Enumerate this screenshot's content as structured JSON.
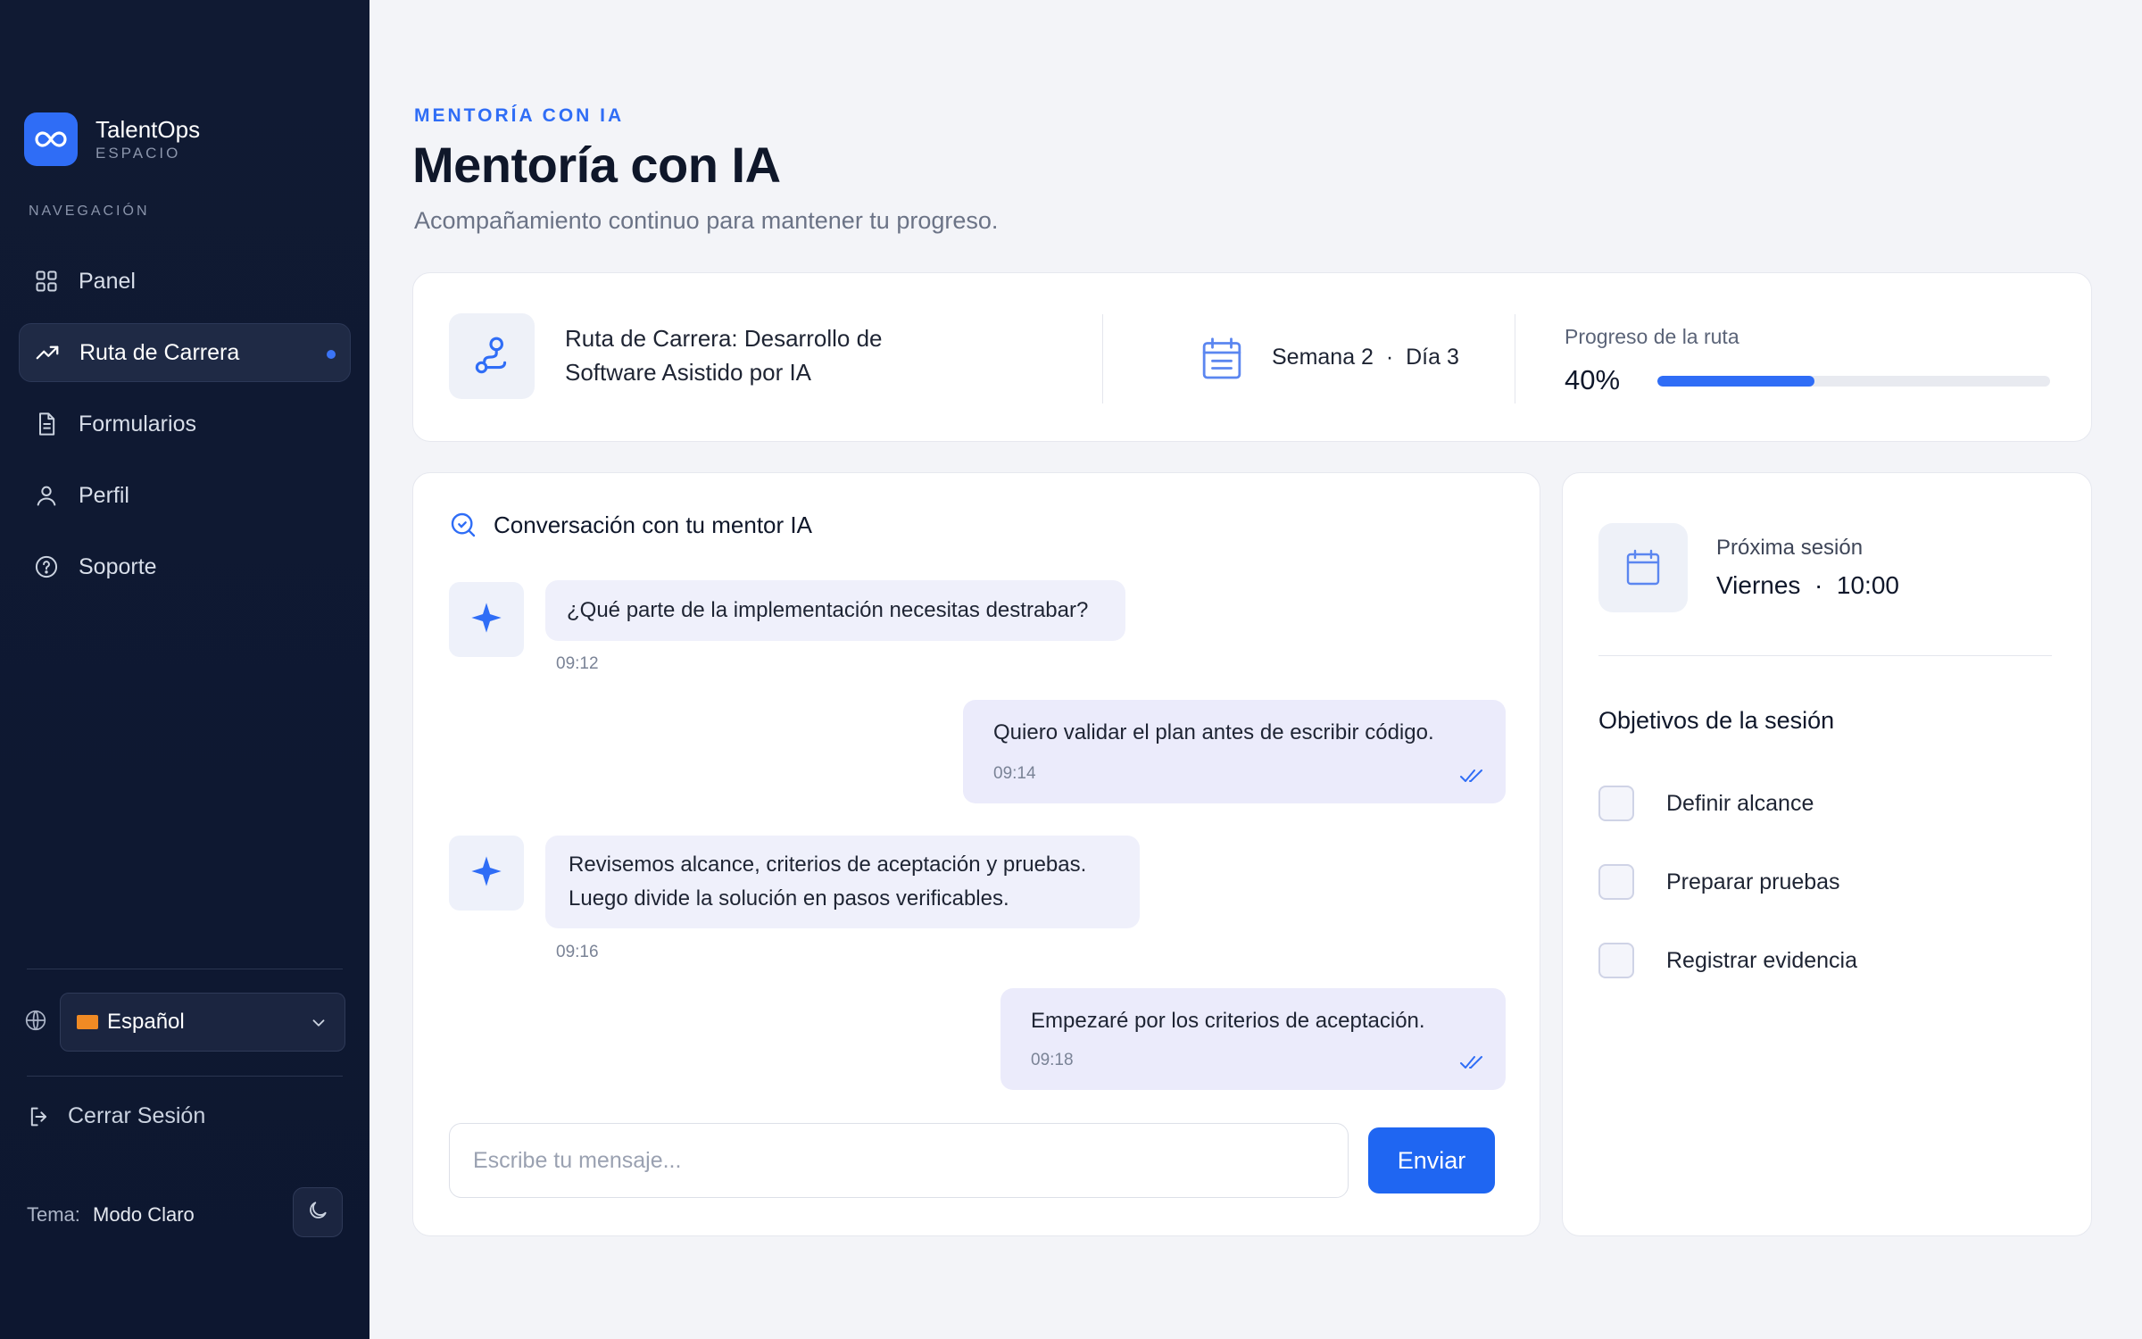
{
  "sidebar": {
    "brand_name": "TalentOps",
    "brand_sub": "ESPACIO",
    "nav_label": "NAVEGACIÓN",
    "items": [
      {
        "label": "Panel",
        "icon": "grid-icon",
        "active": false
      },
      {
        "label": "Ruta de Carrera",
        "icon": "trending-up-icon",
        "active": true
      },
      {
        "label": "Formularios",
        "icon": "document-icon",
        "active": false
      },
      {
        "label": "Perfil",
        "icon": "user-icon",
        "active": false
      },
      {
        "label": "Soporte",
        "icon": "help-circle-icon",
        "active": false
      }
    ],
    "language": "Español",
    "logout_label": "Cerrar Sesión",
    "theme_label": "Tema:",
    "theme_value": "Modo Claro"
  },
  "header": {
    "eyebrow": "MENTORÍA CON IA",
    "title": "Mentoría con IA",
    "subtitle": "Acompañamiento continuo para mantener tu progreso."
  },
  "route": {
    "title": "Ruta de Carrera: Desarrollo de Software Asistido por IA",
    "week": "Semana 2",
    "day": "Día 3",
    "progress_label": "Progreso de la ruta",
    "progress_text": "40%",
    "progress_value": 40
  },
  "chat": {
    "title": "Conversación con tu mentor IA",
    "messages": [
      {
        "from": "bot",
        "text": "¿Qué parte de la implementación necesitas destrabar?",
        "time": "09:12"
      },
      {
        "from": "user",
        "text": "Quiero validar el plan antes de escribir código.",
        "time": "09:14"
      },
      {
        "from": "bot",
        "lines": [
          "Revisemos alcance, criterios de aceptación y pruebas.",
          "Luego divide la solución en pasos verificables."
        ],
        "time": "09:16"
      },
      {
        "from": "user",
        "text": "Empezaré por los criterios de aceptación.",
        "time": "09:18"
      }
    ],
    "input_placeholder": "Escribe tu mensaje...",
    "send_label": "Enviar"
  },
  "session": {
    "label": "Próxima sesión",
    "day": "Viernes",
    "time": "10:00",
    "objectives_title": "Objetivos de la sesión",
    "objectives": [
      "Definir alcance",
      "Preparar pruebas",
      "Registrar evidencia"
    ]
  },
  "colors": {
    "accent": "#2f6df6",
    "sidebar_bg": "#101a33",
    "page_bg": "#f3f4f8",
    "flag": "#f08a24"
  }
}
